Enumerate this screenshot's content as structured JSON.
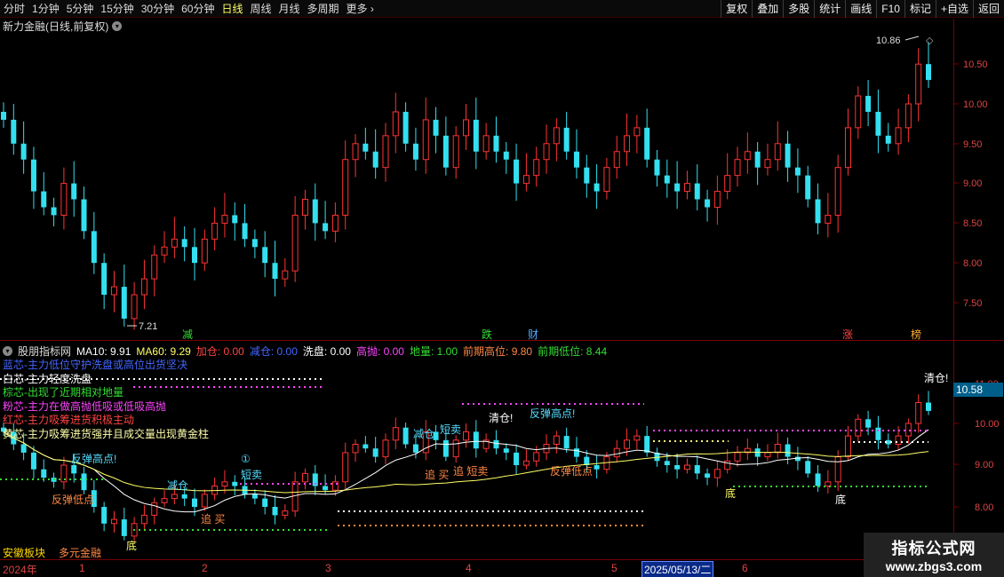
{
  "toolbar": {
    "periods": [
      "分时",
      "1分钟",
      "5分钟",
      "15分钟",
      "30分钟",
      "60分钟",
      "日线",
      "周线",
      "月线",
      "多周期",
      "更多"
    ],
    "active_period": "日线",
    "more_arrow": "›",
    "buttons": [
      "复权",
      "叠加",
      "多股",
      "统计",
      "画线",
      "F10",
      "标记",
      "+自选",
      "返回"
    ]
  },
  "main_panel": {
    "title": "新力金融(日线,前复权)",
    "high_label": "10.86",
    "low_label": "7.21",
    "price_axis": [
      "10.50",
      "10.00",
      "9.50",
      "9.00",
      "8.50",
      "8.00",
      "7.50"
    ],
    "markers": [
      {
        "text": "减",
        "color": "#33dd33"
      },
      {
        "text": "跌",
        "color": "#33dd33"
      },
      {
        "text": "财",
        "color": "#55aaff"
      },
      {
        "text": "涨",
        "color": "#ff4444"
      },
      {
        "text": "榜",
        "color": "#ffaa33"
      }
    ]
  },
  "indicator_bar": {
    "name": "股朋指标网",
    "ma10_label": "MA10:",
    "ma10_value": "9.91",
    "ma60_label": "MA60:",
    "ma60_value": "9.29",
    "items": [
      {
        "label": "加仓:",
        "value": "0.00",
        "color": "#ff4444"
      },
      {
        "label": "减仓:",
        "value": "0.00",
        "color": "#4466ff"
      },
      {
        "label": "洗盘:",
        "value": "0.00",
        "color": "#ffffff"
      },
      {
        "label": "高抛:",
        "value": "0.00",
        "color": "#ff44ff"
      },
      {
        "label": "地量:",
        "value": "1.00",
        "color": "#33dd33"
      },
      {
        "label": "前期高位:",
        "value": "9.80",
        "color": "#ff8844"
      },
      {
        "label": "前期低位:",
        "value": "8.44",
        "color": "#33dd33"
      }
    ]
  },
  "legend": [
    {
      "text": "蓝芯-主力低位守护洗盘或高位出货坚决",
      "color": "#4466ff"
    },
    {
      "text": "白芯-主力轻度洗盘",
      "color": "#ffffff"
    },
    {
      "text": "棕芯-出现了近期相对地量",
      "color": "#33dd33"
    },
    {
      "text": "粉芯-主力在做高抛低吸或低吸高抛",
      "color": "#ff44ff"
    },
    {
      "text": "红芯-主力吸筹进货积极主动",
      "color": "#ff4444"
    },
    {
      "text": "黄芯-主力吸筹进货强并且成交量出现黄金柱",
      "color": "#ffffaa"
    }
  ],
  "indicator_axis": [
    "11.00",
    "10.00",
    "9.00",
    "8.00"
  ],
  "current_price": "10.58",
  "signals": [
    {
      "text": "反弹高点!",
      "color": "#55ddff"
    },
    {
      "text": "反弹低点",
      "color": "#ff8844"
    },
    {
      "text": "减仓",
      "color": "#55ddff"
    },
    {
      "text": "追 买",
      "color": "#ff8844"
    },
    {
      "text": "短卖",
      "color": "#55ddff"
    },
    {
      "text": "①",
      "color": "#55ddff"
    },
    {
      "text": "底",
      "color": "#ffff66"
    },
    {
      "text": "减仓",
      "color": "#55ddff"
    },
    {
      "text": "短卖",
      "color": "#55ddff"
    },
    {
      "text": "追 买",
      "color": "#ff8844"
    },
    {
      "text": "追 短卖",
      "color": "#ff8844"
    },
    {
      "text": "清仓!",
      "color": "#ffffff"
    },
    {
      "text": "反弹高点!",
      "color": "#55ddff"
    },
    {
      "text": "反弹低点",
      "color": "#ff8844"
    },
    {
      "text": "底",
      "color": "#ffff66"
    },
    {
      "text": "底",
      "color": "#ffffff"
    },
    {
      "text": "清仓!",
      "color": "#ffffff"
    }
  ],
  "bottom_tags": {
    "sector": "安徽板块",
    "other": "多元金融"
  },
  "date_axis": {
    "year": "2024年",
    "months": [
      "1",
      "2",
      "3",
      "4",
      "5",
      "6"
    ],
    "highlight": "2025/05/13/二"
  },
  "watermark": {
    "title": "指标公式网",
    "url": "www.zbgs3.com"
  },
  "colors": {
    "up": "#ff3333",
    "down": "#33e0f0",
    "ma_white": "#ffffff",
    "ma_yellow": "#ffff66"
  }
}
